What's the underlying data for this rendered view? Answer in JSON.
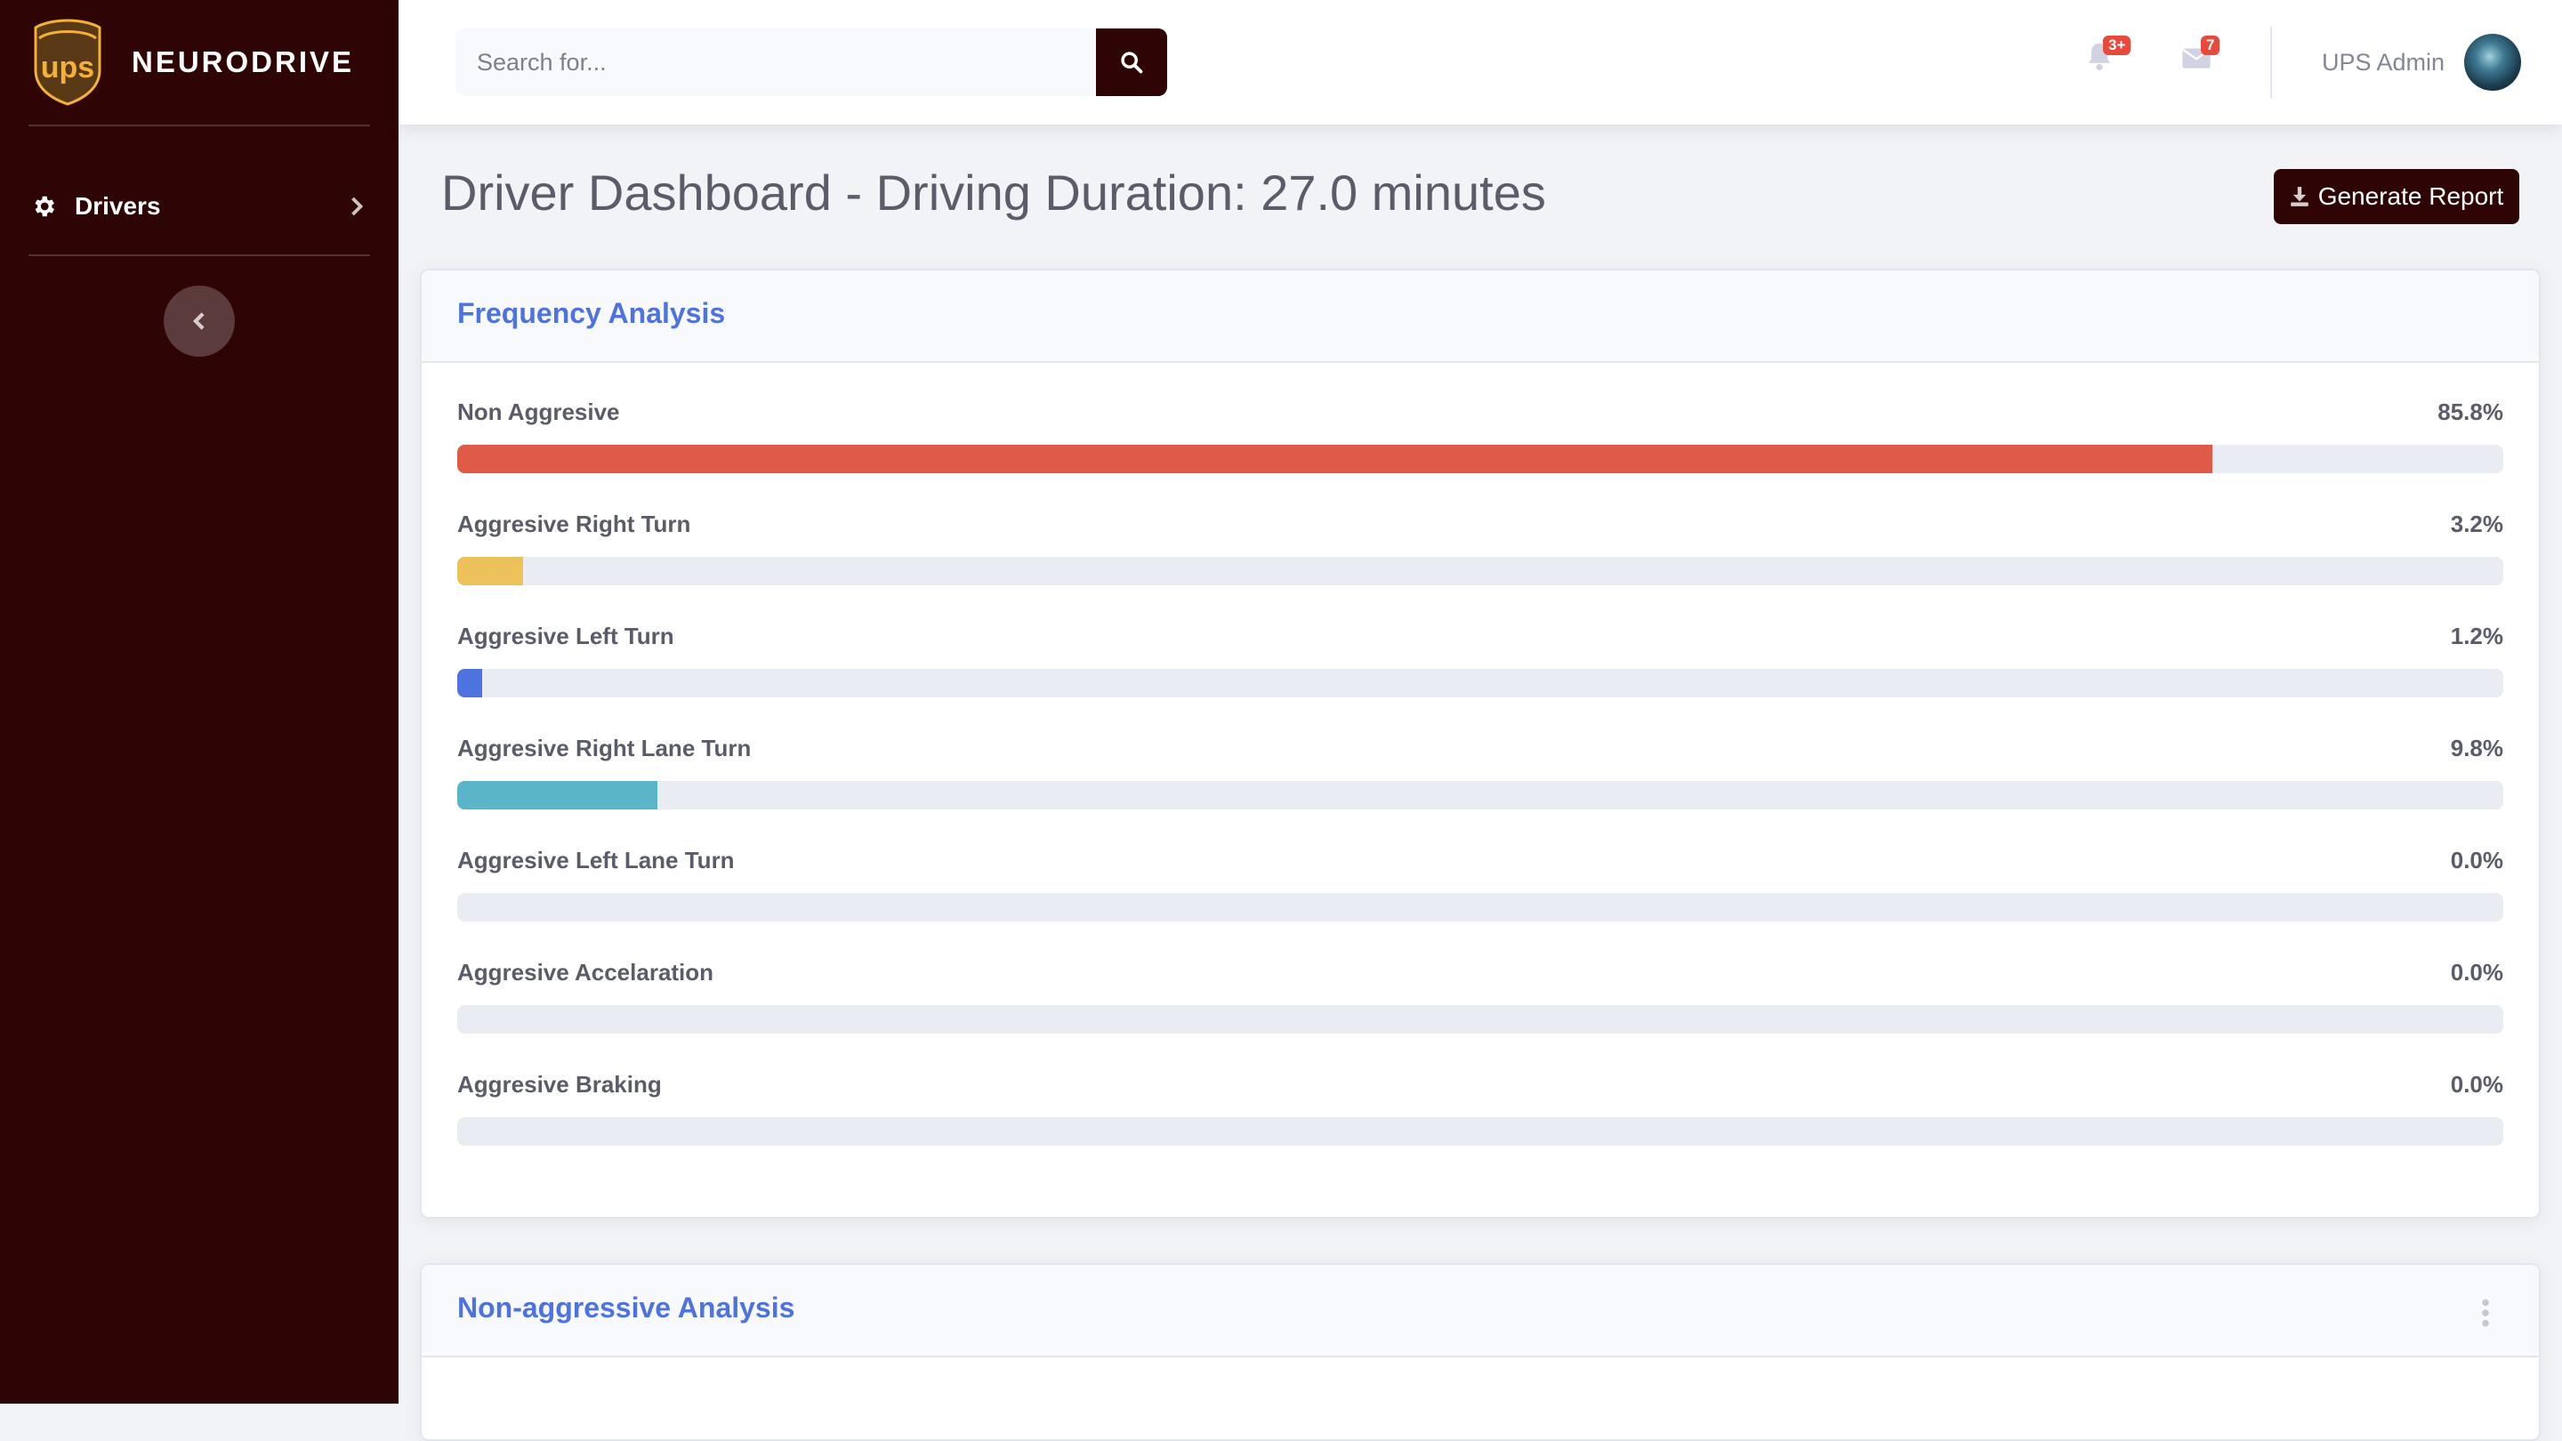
{
  "brand": {
    "name": "NEURODRIVE",
    "logo": "ups-shield-logo"
  },
  "sidebar": {
    "items": [
      {
        "label": "Drivers",
        "icon": "gear-icon"
      }
    ]
  },
  "topbar": {
    "search": {
      "placeholder": "Search for..."
    },
    "alerts": {
      "badge": "3+"
    },
    "messages": {
      "badge": "7"
    },
    "user": {
      "name": "UPS Admin"
    }
  },
  "header": {
    "title": "Driver Dashboard - Driving Duration: 27.0 minutes",
    "report_button": "Generate Report"
  },
  "frequency": {
    "title": "Frequency Analysis",
    "rows": [
      {
        "label": "Non Aggresive",
        "value": "85.8%",
        "pct": 85.8,
        "color": "#e05a48"
      },
      {
        "label": "Aggresive Right Turn",
        "value": "3.2%",
        "pct": 3.2,
        "color": "#edc25a"
      },
      {
        "label": "Aggresive Left Turn",
        "value": "1.2%",
        "pct": 1.2,
        "color": "#4e73df"
      },
      {
        "label": "Aggresive Right Lane Turn",
        "value": "9.8%",
        "pct": 9.8,
        "color": "#5ab5c8"
      },
      {
        "label": "Aggresive Left Lane Turn",
        "value": "0.0%",
        "pct": 0,
        "color": "#4e73df"
      },
      {
        "label": "Aggresive Accelaration",
        "value": "0.0%",
        "pct": 0,
        "color": "#4e73df"
      },
      {
        "label": "Aggresive Braking",
        "value": "0.0%",
        "pct": 0,
        "color": "#4e73df"
      }
    ]
  },
  "non_aggressive": {
    "title": "Non-aggressive Analysis"
  }
}
